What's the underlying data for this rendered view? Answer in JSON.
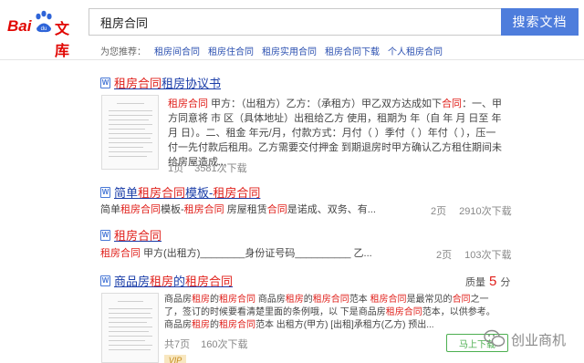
{
  "brand": {
    "bai": "Bai",
    "wenku": "文库"
  },
  "search": {
    "query": "租房合同",
    "button_label": "搜索文档"
  },
  "recommend": {
    "label": "为您推荐：",
    "items": [
      "租房间合同",
      "租房住合同",
      "租房实用合同",
      "租房合同下载",
      "个人租房合同"
    ]
  },
  "results": [
    {
      "title_parts": [
        "租房合同",
        "租房协议书"
      ],
      "snippet_html": "<span class=\"hl\">租房合同</span> 甲方：（出租方）乙方：（承租方）甲乙双方达成如下<span class=\"hl\">合同</span>：一、甲方同意将 市 区（具体地址）出租给乙方 使用，租期为 年（自 年 月 日至 年 月 日）。二、租金 年元/月，付款方式：月付（  ）季付（  ）年付（  ），压一 付一先付款后租用。乙方需要交付押金 到期退房时甲方确认乙方租住期间未 给房屋造成...",
      "pages": "1页",
      "downloads": "3581次下载"
    },
    {
      "title_prefix": "简单",
      "title_hl1": "租房合同",
      "title_mid": "模板-",
      "title_hl2": "租房合同",
      "snippet_html": "简单<span class=\"hl\">租房合同</span>模板-<span class=\"hl\">租房合同</span> 房屋租赁<span class=\"hl\">合同</span>是诺成、双务、有...",
      "pages": "2页",
      "downloads": "2910次下载"
    },
    {
      "title": "租房合同",
      "snippet_html": "<span class=\"hl\">租房合同</span> 甲方(出租方)________身份证号码__________ 乙...",
      "pages": "2页",
      "downloads": "103次下载"
    },
    {
      "title_prefix": "商品房",
      "title_hl1": "租房",
      "title_mid": "的",
      "title_hl2": "租房合同",
      "snippet_html": "商品房<span class=\"hl\">租房</span>的<span class=\"hl\">租房合同</span> 商品房<span class=\"hl\">租房</span>的<span class=\"hl\">租房合同</span>范本 <span class=\"hl\">租房合同</span>是最常见的<span class=\"hl\">合同</span>之一了，签订的时候要看清楚里面的条例哦，以 下是商品房<span class=\"hl\">租房合同</span>范本，以供参考。 商品房<span class=\"hl\">租房</span>的<span class=\"hl\">租房合同</span>范本 出租方(甲方) [出租]承租方(乙方) 预出...",
      "pages": "共7页",
      "downloads": "160次下载",
      "score_label": "质量",
      "score_value": "5",
      "score_unit": "分",
      "vip": "VIP"
    }
  ],
  "mobile_button": "马上下载",
  "watermark": "创业商机"
}
